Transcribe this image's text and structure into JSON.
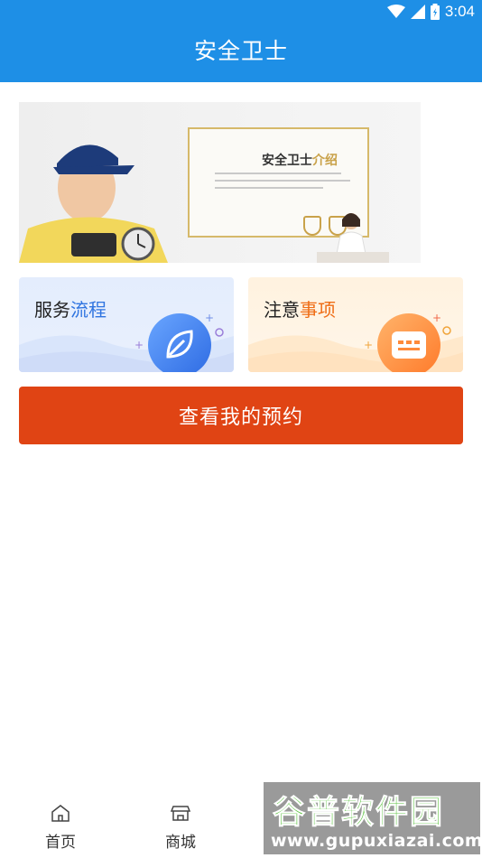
{
  "status_bar": {
    "time": "3:04"
  },
  "app_bar": {
    "title": "安全卫士"
  },
  "banner": {
    "title_main": "安全卫士",
    "title_accent": "介绍"
  },
  "cards": {
    "service": {
      "label_main": "服务",
      "label_accent": "流程",
      "icon": "leaf-icon"
    },
    "notice": {
      "label_main": "注意",
      "label_accent": "事项",
      "icon": "message-icon"
    }
  },
  "actions": {
    "view_reservations": "查看我的预约"
  },
  "bottom_nav": {
    "items": [
      {
        "label": "首页",
        "icon": "home-icon"
      },
      {
        "label": "商城",
        "icon": "store-icon"
      }
    ]
  },
  "watermark": {
    "title": "谷普软件园",
    "url": "www.gupuxiazai.com"
  },
  "colors": {
    "primary": "#1e8fe6",
    "button": "#e04414",
    "service_accent": "#2f74e0",
    "notice_accent": "#ef6d16"
  }
}
